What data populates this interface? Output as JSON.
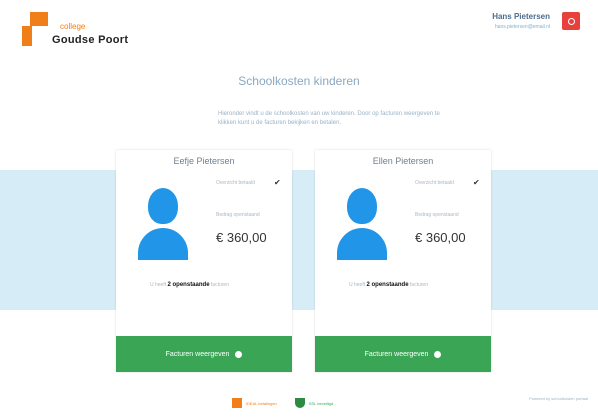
{
  "header": {
    "logo_small": "college",
    "logo_big": "Goudse Poort",
    "user_name": "Hans Pietersen",
    "user_sub": "hans.pietersen@email.nl",
    "logout_icon": "logout-icon"
  },
  "page": {
    "title": "Schoolkosten kinderen",
    "intro": "Hieronder vindt u de schoolkosten van uw kinderen. Door op facturen weergeven te klikken kunt u de facturen bekijken en betalen."
  },
  "cards": [
    {
      "name": "Eefje Pietersen",
      "paid_label": "Overzicht betaald",
      "amount_label": "Bedrag openstaand",
      "amount": "€ 360,00",
      "open_prefix": "U heeft",
      "open_bold": "2 openstaande",
      "open_suffix": "facturen",
      "button": "Facturen weergeven"
    },
    {
      "name": "Ellen Pietersen",
      "paid_label": "Overzicht betaald",
      "amount_label": "Bedrag openstaand",
      "amount": "€ 360,00",
      "open_prefix": "U heeft",
      "open_bold": "2 openstaande",
      "open_suffix": "facturen",
      "button": "Facturen weergeven"
    }
  ],
  "footer": {
    "logo1": "iDEAL betalingen",
    "logo2": "SSL beveiligd",
    "note": "Powered by schoolkosten portaal"
  },
  "colors": {
    "accent_orange": "#f07f1a",
    "button_green": "#3aa655",
    "avatar_blue": "#2196e8",
    "band_blue": "#d6ecf6",
    "logout_red": "#e8413c"
  }
}
